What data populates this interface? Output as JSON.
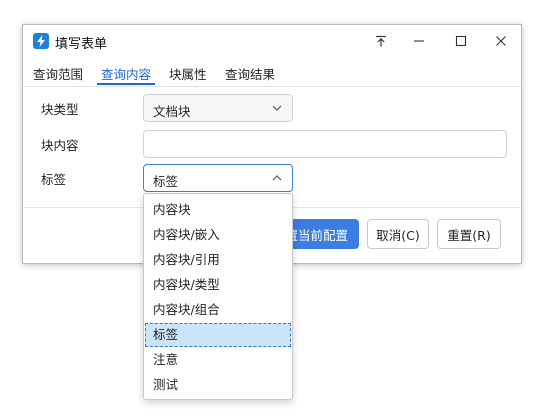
{
  "window": {
    "title": "填写表单"
  },
  "titlebar_icons": [
    "pin-icon",
    "minimize-icon",
    "maximize-icon",
    "close-icon"
  ],
  "tabs": [
    {
      "label": "查询范围",
      "active": false
    },
    {
      "label": "查询内容",
      "active": true
    },
    {
      "label": "块属性",
      "active": false
    },
    {
      "label": "查询结果",
      "active": false
    }
  ],
  "form": {
    "block_type": {
      "label": "块类型",
      "value": "文档块"
    },
    "block_content": {
      "label": "块内容",
      "value": ""
    },
    "tag": {
      "label": "标签",
      "value": "标签"
    }
  },
  "buttons": {
    "apply": "设置当前配置",
    "apply_visible": "置当前配置",
    "cancel": "取消(C)",
    "reset": "重置(R)"
  },
  "dropdown": {
    "options": [
      "内容块",
      "内容块/嵌入",
      "内容块/引用",
      "内容块/类型",
      "内容块/组合",
      "标签",
      "注意",
      "测试"
    ],
    "selected_index": 5
  },
  "colors": {
    "accent": "#1a66d9",
    "primary_button": "#3b7de0",
    "selected_option": "#cce4f7"
  }
}
